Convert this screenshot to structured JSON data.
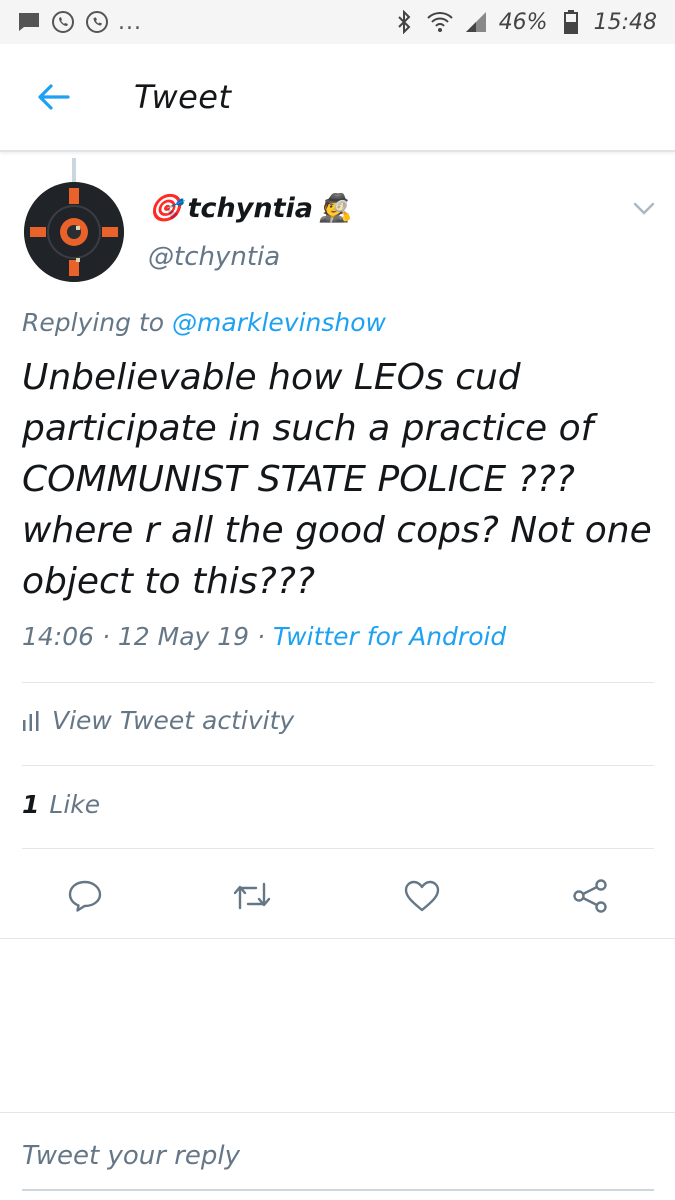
{
  "status_bar": {
    "battery": "46%",
    "time": "15:48",
    "overflow": "..."
  },
  "toolbar": {
    "title": "Tweet"
  },
  "tweet": {
    "display_name": "tchyntia",
    "name_prefix_emoji": "🎯",
    "name_suffix_emoji": "🕵",
    "handle": "@tchyntia",
    "replying_prefix": "Replying to",
    "replying_to": "@marklevinshow",
    "text": "Unbelievable how LEOs cud participate in such a practice of COMMUNIST STATE POLICE ??? where r all the good cops? Not one object to this???",
    "time": "14:06",
    "date": "12 May 19",
    "source": "Twitter for Android",
    "activity_label": "View Tweet activity",
    "likes_count": "1",
    "likes_label": "Like"
  },
  "reply": {
    "placeholder": "Tweet your reply"
  },
  "colors": {
    "accent": "#1da1f2",
    "secondary_text": "#657786",
    "divider": "#e1e8ed"
  },
  "icons": [
    "message-icon",
    "viber-icon",
    "whatsapp-icon",
    "bluetooth-icon",
    "wifi-icon",
    "signal-icon",
    "battery-icon",
    "back-arrow-icon",
    "chevron-down-icon",
    "bar-chart-icon",
    "reply-icon",
    "retweet-icon",
    "heart-icon",
    "share-icon"
  ]
}
